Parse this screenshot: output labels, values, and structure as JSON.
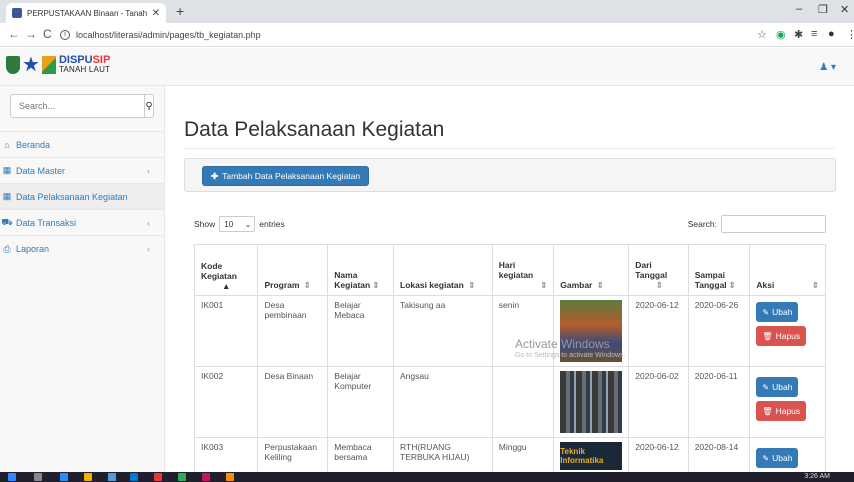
{
  "browser": {
    "tab_title": "PERPUSTAKAAN Binaan - Tanah",
    "tab_close": "✕",
    "new_tab": "+",
    "url": "localhost/literasi/admin/pages/tb_kegiatan.php",
    "minimize": "–",
    "maximize": "❐",
    "close": "✕"
  },
  "header": {
    "brand_top_a": "DISPU",
    "brand_top_b": "SIP",
    "brand_bottom": "TANAH LAUT",
    "user_menu": "♟ ▾"
  },
  "sidebar": {
    "search_placeholder": "Search...",
    "items": [
      {
        "icon": "⌂",
        "label": "Beranda",
        "arrow": ""
      },
      {
        "icon": "▦",
        "label": "Data Master",
        "arrow": "‹"
      },
      {
        "icon": "▦",
        "label": "Data Pelaksanaan Kegiatan",
        "arrow": ""
      },
      {
        "icon": "⛟",
        "label": "Data Transaksi",
        "arrow": "‹"
      },
      {
        "icon": "⎙",
        "label": "Laporan",
        "arrow": "‹"
      }
    ]
  },
  "main": {
    "title": "Data Pelaksanaan Kegiatan",
    "add_button": "Tambah Data Pelaksanaan Kegiatan",
    "show_label": "Show",
    "entries_value": "10",
    "entries_label": "entries",
    "search_label": "Search:"
  },
  "table": {
    "headers": [
      "Kode Kegiatan",
      "Program",
      "Nama Kegiatan",
      "Lokasi kegiatan",
      "Hari kegiatan",
      "Gambar",
      "Dari Tanggal",
      "Sampai Tanggal",
      "Aksi"
    ],
    "rows": [
      {
        "kode": "IK001",
        "program": "Desa pembinaan",
        "nama": "Belajar Mebaca",
        "lokasi": "Takisung aa",
        "hari": "senin",
        "dari": "2020-06-12",
        "sampai": "2020-06-26"
      },
      {
        "kode": "IK002",
        "program": "Desa Binaan",
        "nama": "Belajar Komputer",
        "lokasi": "Angsau",
        "hari": "",
        "dari": "2020-06-02",
        "sampai": "2020-06-11"
      },
      {
        "kode": "IK003",
        "program": "Perpustakaan Keliling",
        "nama": "Membaca bersama",
        "lokasi": "RTH(RUANG TERBUKA HIJAU)",
        "hari": "Minggu",
        "dari": "2020-06-12",
        "sampai": "2020-08-14"
      }
    ],
    "thumb3_text": "Teknik Informatika",
    "ubah_label": "Ubah",
    "hapus_label": "Hapus"
  },
  "watermark": {
    "line1": "Activate Windows",
    "line2": "Go to Settings to activate Windows."
  },
  "taskbar": {
    "time": "3:26 AM"
  },
  "colors": {
    "primary": "#337ab7",
    "danger": "#d9534f",
    "link": "#337ab7"
  }
}
